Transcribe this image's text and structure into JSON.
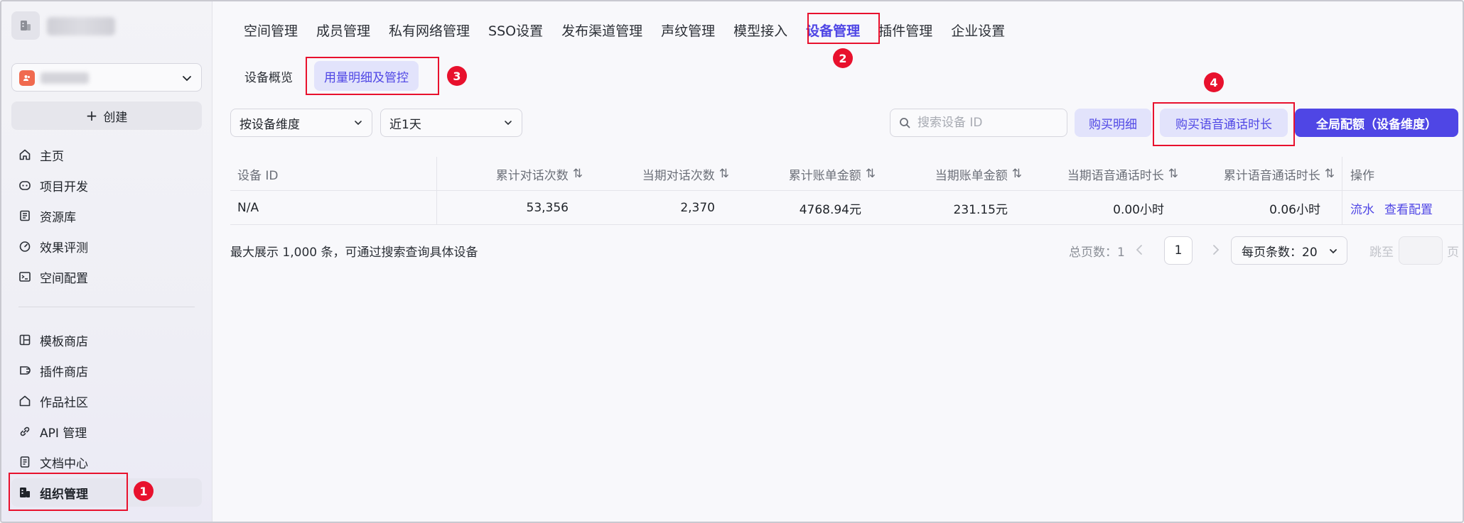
{
  "sidebar": {
    "create_label": "创建",
    "nav_top": [
      {
        "label": "主页",
        "icon": "home-icon"
      },
      {
        "label": "项目开发",
        "icon": "robot-icon"
      },
      {
        "label": "资源库",
        "icon": "library-icon"
      },
      {
        "label": "效果评测",
        "icon": "gauge-icon"
      },
      {
        "label": "空间配置",
        "icon": "terminal-icon"
      }
    ],
    "nav_bottom": [
      {
        "label": "模板商店",
        "icon": "layout-icon"
      },
      {
        "label": "插件商店",
        "icon": "plugin-icon"
      },
      {
        "label": "作品社区",
        "icon": "community-icon"
      },
      {
        "label": "API 管理",
        "icon": "link-icon"
      },
      {
        "label": "文档中心",
        "icon": "document-icon"
      },
      {
        "label": "组织管理",
        "icon": "building-icon"
      }
    ]
  },
  "top_tabs": [
    "空间管理",
    "成员管理",
    "私有网络管理",
    "SSO设置",
    "发布渠道管理",
    "声纹管理",
    "模型接入",
    "设备管理",
    "插件管理",
    "企业设置"
  ],
  "top_tabs_active": "设备管理",
  "sub_tabs": [
    "设备概览",
    "用量明细及管控"
  ],
  "sub_tabs_active": "用量明细及管控",
  "filters": {
    "dimension": "按设备维度",
    "range": "近1天"
  },
  "search": {
    "placeholder": "搜索设备 ID"
  },
  "buttons": {
    "buy_detail": "购买明细",
    "buy_voice": "购买语音通话时长",
    "global_quota": "全局配额（设备维度）"
  },
  "table": {
    "headers": [
      "设备 ID",
      "累计对话次数",
      "当期对话次数",
      "累计账单金额",
      "当期账单金额",
      "当期语音通话时长",
      "累计语音通话时长",
      "操作"
    ],
    "rows": [
      {
        "device_id": "N/A",
        "total_dialogs": "53,356",
        "period_dialogs": "2,370",
        "total_bill": "4768.94元",
        "period_bill": "231.15元",
        "period_voice": "0.00小时",
        "total_voice": "0.06小时",
        "actions": [
          "流水",
          "查看配置"
        ]
      }
    ]
  },
  "footer_note": "最大展示 1,000 条，可通过搜索查询具体设备",
  "pagination": {
    "total_label": "总页数：1",
    "current_page": "1",
    "page_size_label": "每页条数：20",
    "jump_label": "跳至",
    "jump_suffix": "页"
  },
  "annotations": [
    "1",
    "2",
    "3",
    "4"
  ],
  "colors": {
    "accent": "#4f46e5",
    "accent_light": "#e2e3fb",
    "highlight": "#e8112d"
  }
}
